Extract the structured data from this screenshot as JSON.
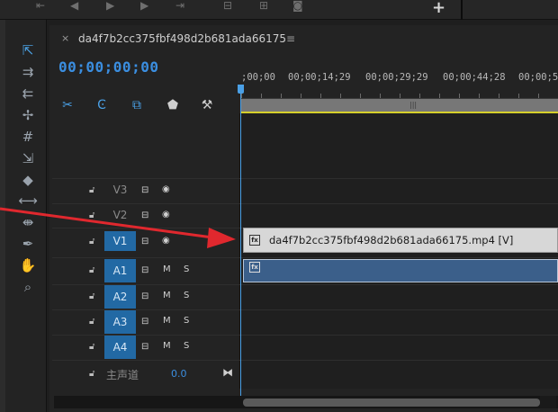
{
  "sequence": {
    "tab_close": "×",
    "title": "da4f7b2cc375fbf498d2b681ada66175",
    "menu_icon": "≡",
    "timecode": "00;00;00;00"
  },
  "ruler": {
    "labels": [
      ";00;00",
      "00;00;14;29",
      "00;00;29;29",
      "00;00;44;28",
      "00;00;5"
    ]
  },
  "tracks": {
    "video": [
      {
        "name": "V3",
        "active": false
      },
      {
        "name": "V2",
        "active": false
      },
      {
        "name": "V1",
        "active": true
      }
    ],
    "audio": [
      {
        "name": "A1",
        "m": "M",
        "s": "S"
      },
      {
        "name": "A2",
        "m": "M",
        "s": "S"
      },
      {
        "name": "A3",
        "m": "M",
        "s": "S"
      },
      {
        "name": "A4",
        "m": "M",
        "s": "S"
      }
    ],
    "master": {
      "label": "主声道",
      "value": "0.0"
    }
  },
  "clips": {
    "video_clip": "da4f7b2cc375fbf498d2b681ada66175.mp4 [V]",
    "fx_badge": "fx"
  },
  "colors": {
    "accent": "#3b8ee0",
    "track_selected": "#2269a4",
    "workarea": "#d5cf2a",
    "annotation_arrow": "#e0282e"
  },
  "icons": {
    "tools": [
      "selection-tool-icon",
      "track-select-forward-icon",
      "track-select-backward-icon",
      "ripple-edit-icon",
      "rolling-edit-icon",
      "rate-stretch-icon",
      "razor-icon",
      "slip-icon",
      "slide-icon",
      "pen-icon",
      "hand-icon",
      "zoom-icon"
    ]
  }
}
